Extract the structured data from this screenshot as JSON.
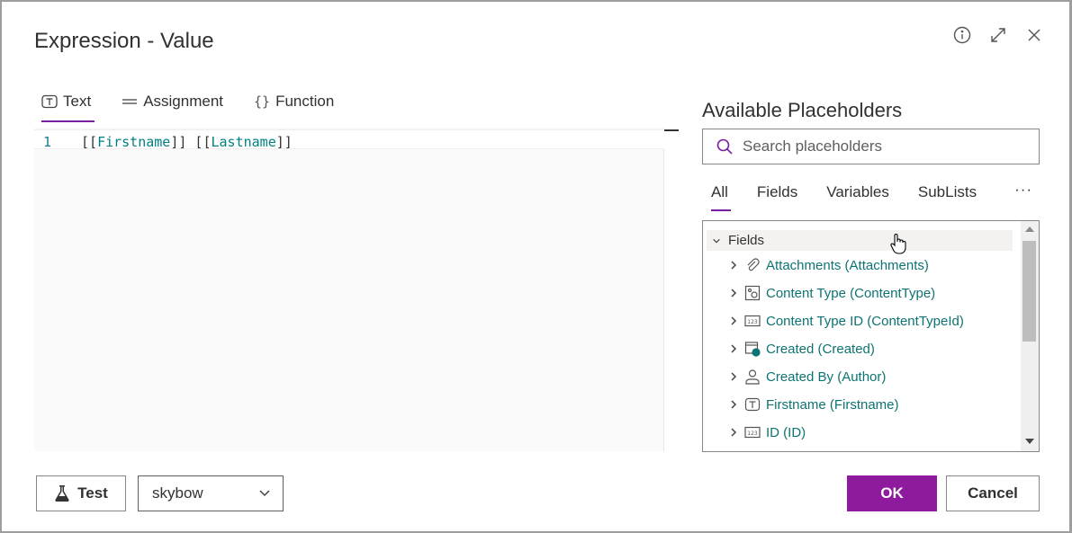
{
  "dialog": {
    "title": "Expression - Value",
    "icons": [
      "info-icon",
      "expand-icon",
      "close-icon"
    ]
  },
  "editor_tabs": [
    {
      "label": "Text",
      "icon": "text-icon",
      "active": true
    },
    {
      "label": "Assignment",
      "icon": "assignment-icon",
      "active": false
    },
    {
      "label": "Function",
      "icon": "braces-icon",
      "active": false
    }
  ],
  "editor": {
    "line_number": "1",
    "code_parts": [
      "[[",
      "Firstname",
      "]] [[",
      "Lastname",
      "]]"
    ]
  },
  "placeholders": {
    "title": "Available Placeholders",
    "search_placeholder": "Search placeholders",
    "tabs": [
      "All",
      "Fields",
      "Variables",
      "SubLists"
    ],
    "more_label": "···",
    "tree": {
      "group_label": "Fields",
      "items": [
        {
          "label": "Attachments (Attachments)",
          "icon": "paperclip-icon"
        },
        {
          "label": "Content Type (ContentType)",
          "icon": "content-type-icon"
        },
        {
          "label": "Content Type ID (ContentTypeId)",
          "icon": "number-icon"
        },
        {
          "label": "Created (Created)",
          "icon": "calendar-clock-icon"
        },
        {
          "label": "Created By (Author)",
          "icon": "person-icon"
        },
        {
          "label": "Firstname (Firstname)",
          "icon": "text-icon"
        },
        {
          "label": "ID (ID)",
          "icon": "number-icon"
        }
      ]
    }
  },
  "footer": {
    "test_label": "Test",
    "select_value": "skybow",
    "ok_label": "OK",
    "cancel_label": "Cancel"
  },
  "colors": {
    "accent": "#8e1b9e",
    "placeholder_text": "#0e7373"
  }
}
